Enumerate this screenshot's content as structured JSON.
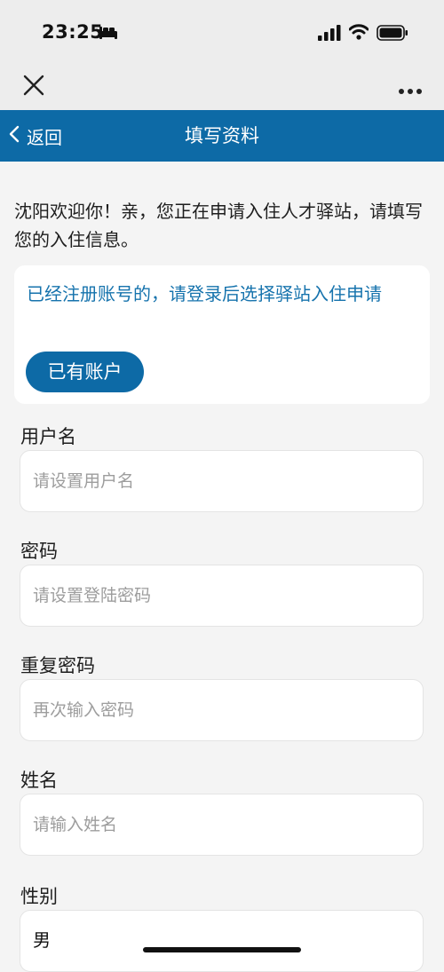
{
  "status_bar": {
    "time": "23:25"
  },
  "nav": {
    "back_label": "返回",
    "title": "填写资料"
  },
  "intro_text": "沈阳欢迎你！亲，您正在申请入住人才驿站，请填写您的入住信息。",
  "notice": {
    "text": "已经注册账号的，请登录后选择驿站入住申请",
    "button_label": "已有账户"
  },
  "form": {
    "username": {
      "label": "用户名",
      "placeholder": "请设置用户名",
      "value": ""
    },
    "password": {
      "label": "密码",
      "placeholder": "请设置登陆密码",
      "value": ""
    },
    "confirm_password": {
      "label": "重复密码",
      "placeholder": "再次输入密码",
      "value": ""
    },
    "name": {
      "label": "姓名",
      "placeholder": "请输入姓名",
      "value": ""
    },
    "gender": {
      "label": "性别",
      "value": "男"
    }
  },
  "colors": {
    "brand": "#0d6aa6",
    "link_text": "#1673ad",
    "background": "#f4f4f4"
  },
  "icons": [
    "bed-icon",
    "signal-icon",
    "wifi-icon",
    "battery-icon",
    "close-icon",
    "more-icon",
    "chevron-left-icon"
  ]
}
